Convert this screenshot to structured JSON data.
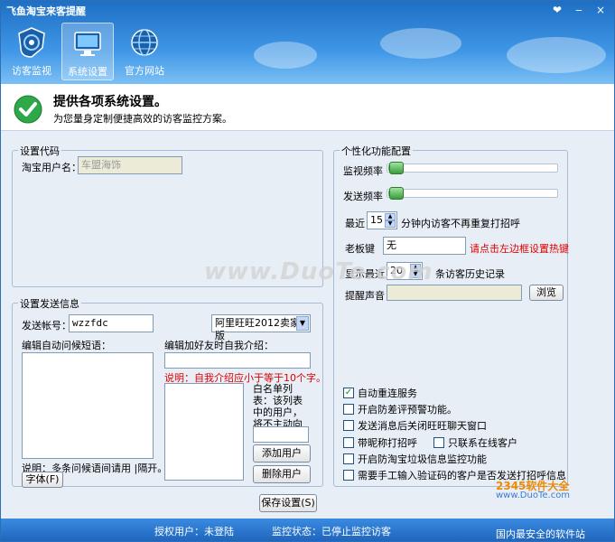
{
  "window": {
    "title": "飞鱼淘宝来客提醒",
    "controls": [
      "❤",
      "‒",
      "×"
    ]
  },
  "nav": [
    {
      "label": "访客监视",
      "icon": "shield-radar-icon"
    },
    {
      "label": "系统设置",
      "icon": "monitor-settings-icon",
      "active": true
    },
    {
      "label": "官方网站",
      "icon": "globe-icon"
    }
  ],
  "info": {
    "title": "提供各项系统设置。",
    "subtitle": "为您量身定制便捷高效的访客监控方案。"
  },
  "code_group": {
    "label": "设置代码",
    "username_label": "淘宝用户名：",
    "username_value": "车盟海饰"
  },
  "send_group": {
    "label": "设置发送信息",
    "account_label": "发送帐号：",
    "account_value": "wzzfdc",
    "client_select": "阿里旺旺2012卖家版",
    "greeting_label": "编辑自动问候短语：",
    "intro_label": "编辑加好友时自我介绍：",
    "intro_note": "说明：自我介绍应小于等于10个字。",
    "whitelist_note": "白名单列表：该列表中的用户，将不主动向其打招呼。",
    "add_user": "添加用户",
    "delete_user": "删除用户",
    "bottom_note": "说明：多条问候语间请用 |隔开。",
    "font_button": "字体(F)"
  },
  "custom_group": {
    "label": "个性化功能配置",
    "monitor_freq": "监视频率",
    "monitor_freq_level": 0.05,
    "send_freq": "发送频率",
    "send_freq_level": 0.05,
    "recent_label": "最近",
    "recent_value": "15",
    "recent_suffix": "分钟内访客不再重复打招呼",
    "boss_key_label": "老板键",
    "boss_key_value": "无",
    "boss_key_hint": "请点击左边框设置热键",
    "show_recent_label": "显示最近",
    "show_recent_value": "20",
    "show_recent_suffix": "条访客历史记录",
    "sound_label": "提醒声音",
    "browse": "浏览",
    "checks": [
      {
        "label": "自动重连服务",
        "checked": true
      },
      {
        "label": "开启防差评预警功能。",
        "checked": false
      },
      {
        "label": "发送消息后关闭旺旺聊天窗口",
        "checked": false
      },
      {
        "label": "带昵称打招呼",
        "checked": false
      },
      {
        "label": "只联系在线客户",
        "checked": false
      },
      {
        "label": "开启防淘宝垃圾信息监控功能",
        "checked": false
      },
      {
        "label": "需要手工输入验证码的客户是否发送打招呼信息",
        "checked": false
      }
    ]
  },
  "save_button": "保存设置(S)",
  "status": {
    "auth": "授权用户：未登陆",
    "monitor": "监控状态：已停止监控访客"
  },
  "watermarks": {
    "center": "www.DuoTe.com",
    "logo": "2345软件大全",
    "logo_url": "www.DuoTe.com",
    "footer": "国内最安全的软件站"
  }
}
